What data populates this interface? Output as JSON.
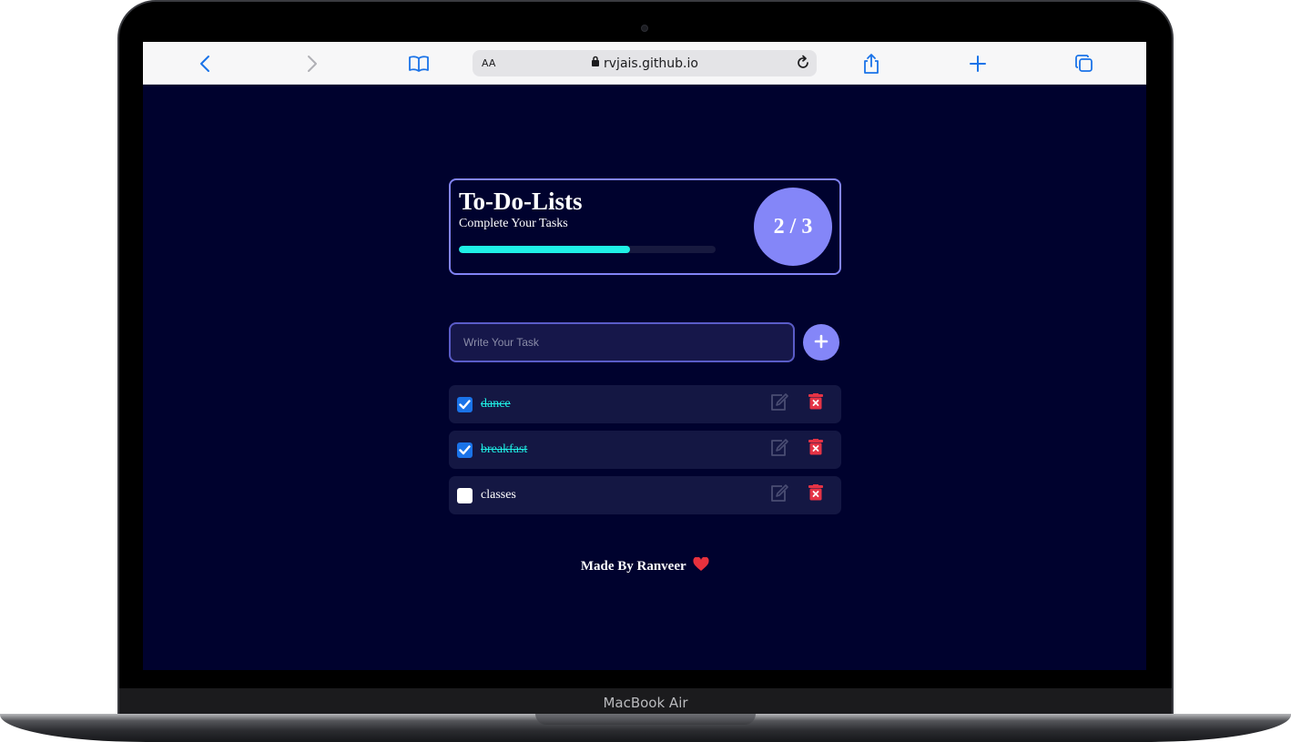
{
  "device": {
    "label": "MacBook Air"
  },
  "browser": {
    "text_size_label": "AA",
    "url": "rvjais.github.io",
    "icons": [
      "back-icon",
      "forward-icon",
      "bookmarks-icon",
      "lock-icon",
      "reload-icon",
      "share-icon",
      "new-tab-icon",
      "tabs-icon"
    ]
  },
  "app": {
    "title": "To-Do-Lists",
    "subtitle": "Complete Your Tasks",
    "progress": {
      "completed": 2,
      "total": 3,
      "label": "2 / 3",
      "fraction": 0.667
    },
    "input": {
      "placeholder": "Write Your Task",
      "value": ""
    },
    "add_button_icon": "plus-icon",
    "tasks": [
      {
        "text": "dance",
        "completed": true
      },
      {
        "text": "breakfast",
        "completed": true
      },
      {
        "text": "classes",
        "completed": false
      }
    ],
    "footer": "Made By Ranveer"
  },
  "colors": {
    "background": "#00022e",
    "accent": "#8486f8",
    "progress": "#1ff0e6",
    "delete": "#e53345"
  }
}
